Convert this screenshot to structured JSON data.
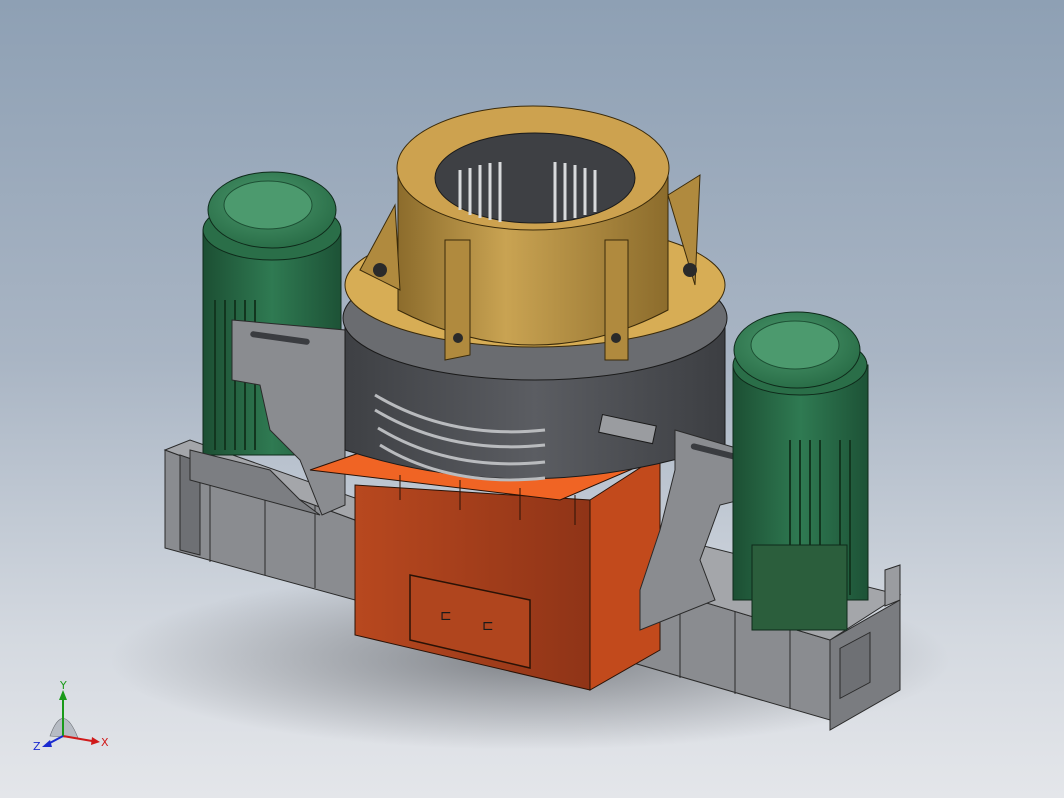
{
  "viewport": {
    "background_top": "#8ea0b4",
    "background_bottom": "#e4e6ea"
  },
  "colors": {
    "frame_gray": "#8a8c90",
    "frame_gray_dark": "#5e6064",
    "housing_dark": "#4e5054",
    "motor_green": "#2f7a52",
    "motor_green_dark": "#1f5a3a",
    "cover_gold": "#c09a4a",
    "cover_gold_dark": "#8c6c2c",
    "base_orange": "#e05a20",
    "base_rust": "#a8401e"
  },
  "triad": {
    "x_label": "X",
    "y_label": "Y",
    "z_label": "Z"
  }
}
